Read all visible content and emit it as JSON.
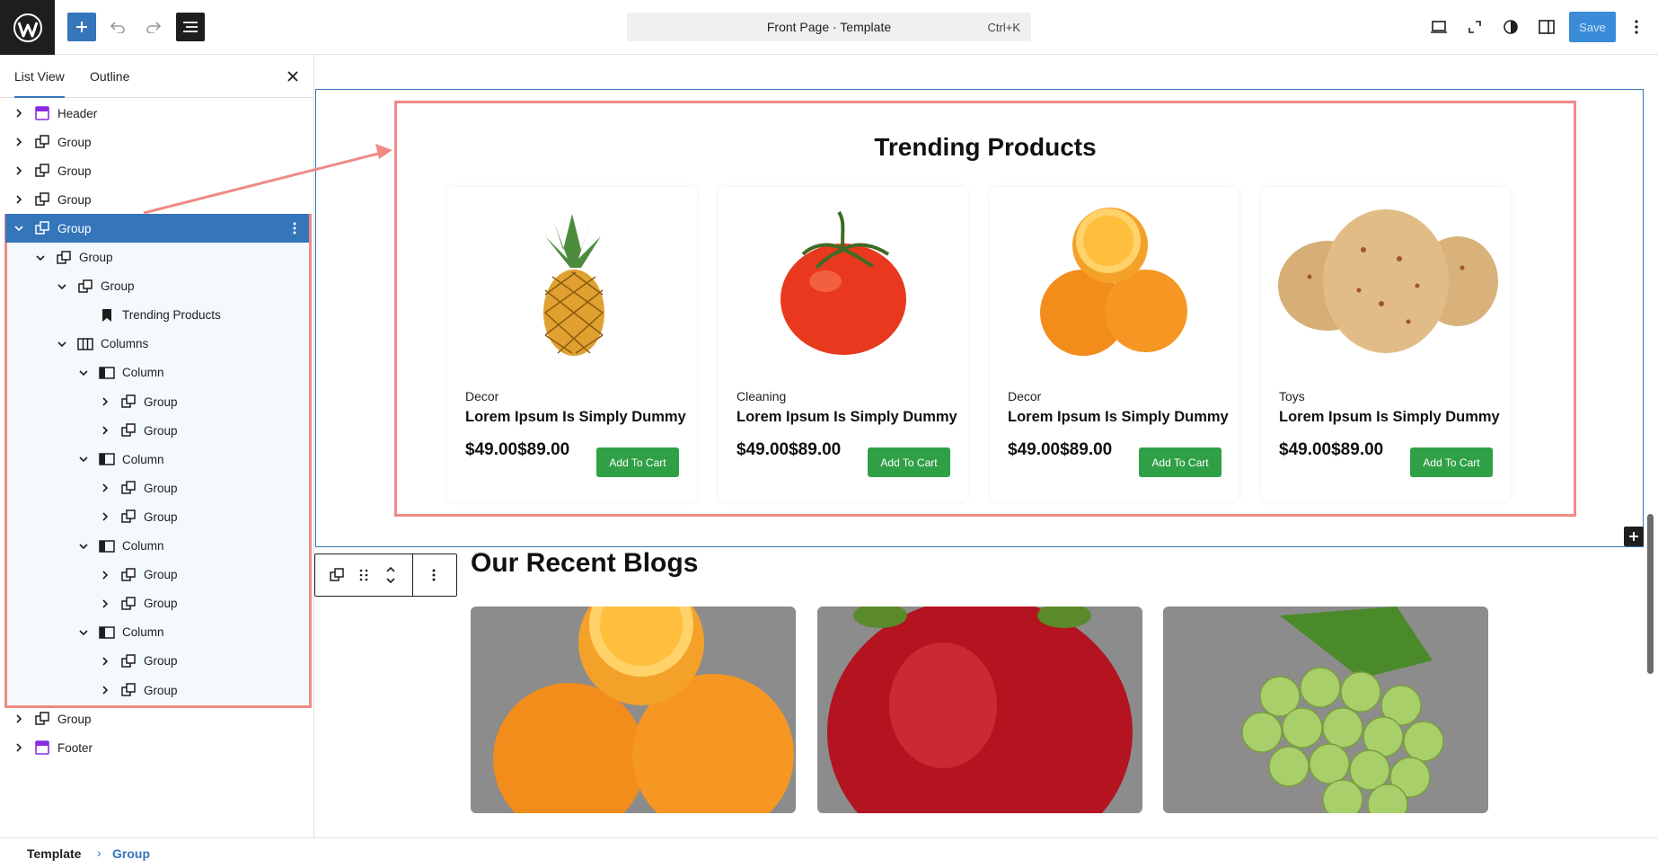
{
  "topbar": {
    "command_label": "Front Page · Template",
    "command_shortcut": "Ctrl+K",
    "save_label": "Save"
  },
  "sidebar": {
    "tabs": [
      {
        "label": "List View"
      },
      {
        "label": "Outline"
      }
    ],
    "tree": [
      {
        "label": "Header",
        "icon": "template-part-icon"
      },
      {
        "label": "Group",
        "icon": "group-icon"
      },
      {
        "label": "Group",
        "icon": "group-icon"
      },
      {
        "label": "Group",
        "icon": "group-icon"
      },
      {
        "label": "Group",
        "icon": "group-icon",
        "selected": true
      },
      {
        "label": "Group",
        "icon": "group-icon"
      },
      {
        "label": "Group",
        "icon": "group-icon"
      },
      {
        "label": "Trending Products",
        "icon": "bookmark-icon"
      },
      {
        "label": "Columns",
        "icon": "columns-icon"
      },
      {
        "label": "Column",
        "icon": "column-icon"
      },
      {
        "label": "Group",
        "icon": "group-icon"
      },
      {
        "label": "Group",
        "icon": "group-icon"
      },
      {
        "label": "Column",
        "icon": "column-icon"
      },
      {
        "label": "Group",
        "icon": "group-icon"
      },
      {
        "label": "Group",
        "icon": "group-icon"
      },
      {
        "label": "Column",
        "icon": "column-icon"
      },
      {
        "label": "Group",
        "icon": "group-icon"
      },
      {
        "label": "Group",
        "icon": "group-icon"
      },
      {
        "label": "Column",
        "icon": "column-icon"
      },
      {
        "label": "Group",
        "icon": "group-icon"
      },
      {
        "label": "Group",
        "icon": "group-icon"
      },
      {
        "label": "Group",
        "icon": "group-icon"
      },
      {
        "label": "Footer",
        "icon": "template-part-icon"
      }
    ]
  },
  "canvas": {
    "trending_title": "Trending Products",
    "products": [
      {
        "category": "Decor",
        "title": "Lorem Ipsum Is Simply Dummy",
        "price": "$49.00$89.00",
        "cart_label": "Add To Cart",
        "image": "pineapple"
      },
      {
        "category": "Cleaning",
        "title": "Lorem Ipsum Is Simply Dummy",
        "price": "$49.00$89.00",
        "cart_label": "Add To Cart",
        "image": "tomato"
      },
      {
        "category": "Decor",
        "title": "Lorem Ipsum Is Simply Dummy",
        "price": "$49.00$89.00",
        "cart_label": "Add To Cart",
        "image": "oranges"
      },
      {
        "category": "Toys",
        "title": "Lorem Ipsum Is Simply Dummy",
        "price": "$49.00$89.00",
        "cart_label": "Add To Cart",
        "image": "potatoes"
      }
    ],
    "blogs_title": "Our Recent Blogs",
    "blog_images": [
      "oranges",
      "apple",
      "grapes"
    ]
  },
  "breadcrumb": [
    {
      "label": "Template"
    },
    {
      "label": "Group"
    }
  ],
  "colors": {
    "accent": "#3575ba",
    "annotation": "#f08a85",
    "cart_button": "#30a046"
  }
}
